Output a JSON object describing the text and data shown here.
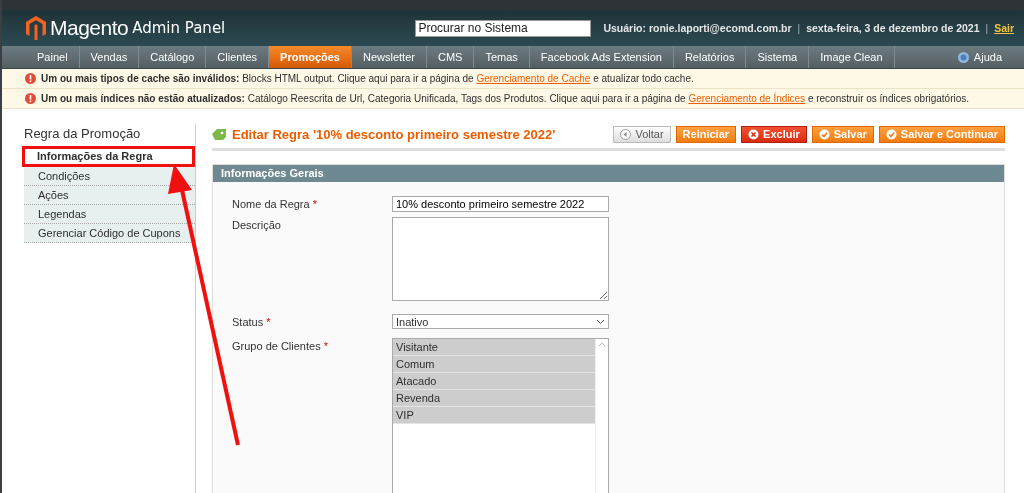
{
  "header": {
    "logo": "Magento",
    "logo_suffix": "Admin Panel",
    "search": {
      "placeholder": "Procurar no Sistema"
    },
    "user": "Usuário: ronie.laporti@ecomd.com.br",
    "separator_1": "|",
    "date": "sexta-feira, 3 de dezembro de 2021",
    "separator_2": "|",
    "logout": "Sair"
  },
  "nav": {
    "items": [
      {
        "label": "Painel",
        "selected": false
      },
      {
        "label": "Vendas",
        "selected": false
      },
      {
        "label": "Catálogo",
        "selected": false
      },
      {
        "label": "Clientes",
        "selected": false
      },
      {
        "label": "Promoções",
        "selected": true
      },
      {
        "label": "Newsletter",
        "selected": false
      },
      {
        "label": "CMS",
        "selected": false
      },
      {
        "label": "Temas",
        "selected": false
      },
      {
        "label": "Facebook Ads Extension",
        "selected": false
      },
      {
        "label": "Relatórios",
        "selected": false
      },
      {
        "label": "Sistema",
        "selected": false
      },
      {
        "label": "Image Clean",
        "selected": false
      }
    ],
    "help": "Ajuda"
  },
  "notices": [
    {
      "bold": "Um ou mais tipos de cache são inválidos:",
      "text": "Blocks HTML output. Clique aqui para ir a página de",
      "link": "Gerenciamento de Cache",
      "after": "e atualizar todo cache."
    },
    {
      "bold": "Um ou mais índices não estão atualizados:",
      "text": "Catálogo Reescrita de Url, Categoria Unificada, Tags dos Produtos. Clique aqui para ir a página de",
      "link": "Gerenciamento de Índices",
      "after": "e reconstruir os índices obrigatórios."
    }
  ],
  "sidebar": {
    "title": "Regra da Promoção",
    "items": [
      {
        "label": "Informações da Regra",
        "selected": true,
        "highlighted": true
      },
      {
        "label": "Condições",
        "selected": false,
        "highlighted": false
      },
      {
        "label": "Ações",
        "selected": false,
        "highlighted": false
      },
      {
        "label": "Legendas",
        "selected": false,
        "highlighted": false
      },
      {
        "label": "Gerenciar Código de Cupons",
        "selected": false,
        "highlighted": false
      }
    ]
  },
  "page": {
    "title": "Editar Regra '10% desconto primeiro semestre 2022'",
    "buttons": [
      {
        "label": "Voltar",
        "kind": "back"
      },
      {
        "label": "Reiniciar",
        "kind": "plain"
      },
      {
        "label": "Excluir",
        "kind": "delete"
      },
      {
        "label": "Salvar",
        "kind": "save"
      },
      {
        "label": "Salvar e Continuar",
        "kind": "save"
      }
    ]
  },
  "section": {
    "title": "Informações Gerais",
    "fields": [
      {
        "label": "Nome da Regra",
        "required_mark": "*",
        "kind": "text",
        "value": "10% desconto primeiro semestre 2022"
      },
      {
        "label": "Descrição",
        "kind": "textarea"
      },
      {
        "label": "Status",
        "required_mark": "*",
        "kind": "select",
        "value": "Inativo"
      },
      {
        "label": "Grupo de Clientes",
        "required_mark": "*",
        "kind": "multiselect",
        "options": [
          {
            "label": "Visitante",
            "selected": true
          },
          {
            "label": "Comum",
            "selected": true
          },
          {
            "label": "Atacado",
            "selected": true
          },
          {
            "label": "Revenda",
            "selected": true
          },
          {
            "label": "VIP",
            "selected": true
          }
        ]
      }
    ]
  }
}
